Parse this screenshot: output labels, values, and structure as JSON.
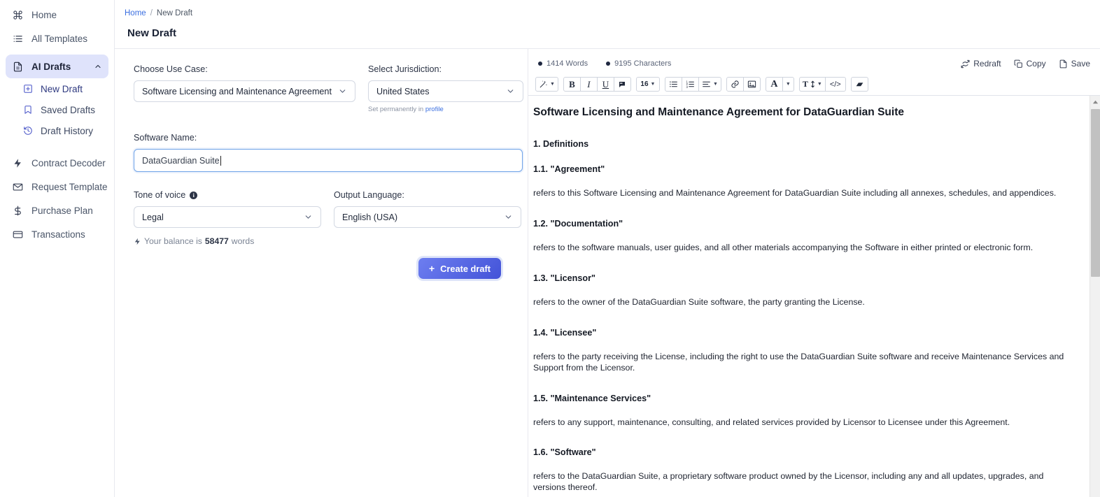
{
  "sidebar": {
    "items": [
      {
        "label": "Home",
        "icon": "command-icon"
      },
      {
        "label": "All Templates",
        "icon": "list-icon"
      },
      {
        "label": "AI Drafts",
        "icon": "document-icon",
        "active": true,
        "expanded": true
      },
      {
        "label": "New Draft",
        "icon": "plus-square-icon",
        "sub": true
      },
      {
        "label": "Saved Drafts",
        "icon": "bookmark-icon",
        "sub": true
      },
      {
        "label": "Draft History",
        "icon": "history-icon",
        "sub": true
      },
      {
        "label": "Contract Decoder",
        "icon": "bolt-icon"
      },
      {
        "label": "Request Template",
        "icon": "envelope-icon"
      },
      {
        "label": "Purchase Plan",
        "icon": "dollar-icon"
      },
      {
        "label": "Transactions",
        "icon": "card-icon"
      }
    ]
  },
  "breadcrumb": {
    "home": "Home",
    "separator": "/",
    "current": "New Draft"
  },
  "page": {
    "title": "New Draft"
  },
  "form": {
    "use_case": {
      "label": "Choose Use Case:",
      "value": "Software Licensing and Maintenance Agreement"
    },
    "jurisdiction": {
      "label": "Select Jurisdiction:",
      "value": "United States",
      "hint_prefix": "Set permanently in ",
      "hint_link": "profile"
    },
    "software_name": {
      "label": "Software Name:",
      "value": "DataGuardian Suite",
      "placeholder": ""
    },
    "tone": {
      "label": "Tone of voice",
      "value": "Legal",
      "info_glyph": "i"
    },
    "language": {
      "label": "Output Language:",
      "value": "English (USA)"
    },
    "balance": {
      "prefix": "Your balance is",
      "amount": "58477",
      "suffix": "words"
    },
    "create_button": {
      "label": "Create draft",
      "icon": "plus-icon"
    }
  },
  "editor": {
    "stats": [
      {
        "value": "1414 Words"
      },
      {
        "value": "9195 Characters"
      }
    ],
    "actions": [
      {
        "label": "Redraft",
        "icon": "refresh-icon"
      },
      {
        "label": "Copy",
        "icon": "copy-icon"
      },
      {
        "label": "Save",
        "icon": "file-icon"
      }
    ],
    "toolbar": {
      "magic": "magic-wand-icon",
      "bold": "B",
      "italic": "I",
      "underline": "U",
      "highlight": "highlighter-icon",
      "font_size": "16",
      "bullet_list": "bullet-list-icon",
      "numbered_list": "numbered-list-icon",
      "align": "align-icon",
      "link": "link-icon",
      "image": "image-icon",
      "font_color": "A",
      "line_height": "T",
      "code": "</>",
      "eraser": "eraser-icon"
    },
    "document": {
      "title": "Software Licensing and Maintenance Agreement for DataGuardian Suite",
      "section_heading": "1. Definitions",
      "clauses": [
        {
          "heading": "1.1. \"Agreement\"",
          "body": "refers to this Software Licensing and Maintenance Agreement for DataGuardian Suite including all annexes, schedules, and appendices."
        },
        {
          "heading": "1.2. \"Documentation\"",
          "body": "refers to the software manuals, user guides, and all other materials accompanying the Software in either printed or electronic form."
        },
        {
          "heading": "1.3. \"Licensor\"",
          "body": "refers to the owner of the DataGuardian Suite software, the party granting the License."
        },
        {
          "heading": "1.4. \"Licensee\"",
          "body": "refers to the party receiving the License, including the right to use the DataGuardian Suite software and receive Maintenance Services and Support from the Licensor."
        },
        {
          "heading": "1.5. \"Maintenance Services\"",
          "body": "refers to any support, maintenance, consulting, and related services provided by Licensor to Licensee under this Agreement."
        },
        {
          "heading": "1.6. \"Software\"",
          "body": "refers to the DataGuardian Suite, a proprietary software product owned by the Licensor, including any and all updates, upgrades, and versions thereof."
        }
      ]
    }
  },
  "colors": {
    "accent": "#4353d8",
    "link": "#3b6fe0",
    "active_nav_bg": "#dfe3fb",
    "text": "#1f2738"
  }
}
